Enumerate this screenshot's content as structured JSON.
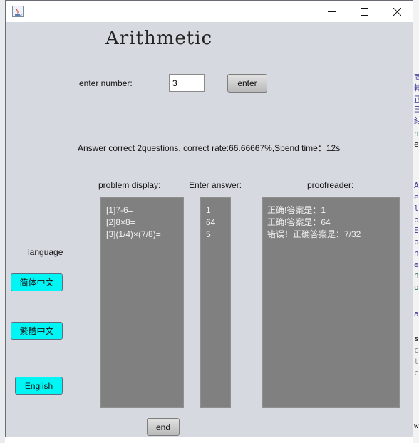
{
  "window": {
    "controls": {
      "minimize": "—",
      "maximize": "☐",
      "close": "✕"
    },
    "icon": "java-app-icon"
  },
  "app": {
    "title": "Arithmetic"
  },
  "input": {
    "label": "enter number:",
    "value": "3"
  },
  "buttons": {
    "enter": "enter",
    "end": "end"
  },
  "result_text": "Answer correct 2questions, correct rate:66.66667%,Spend time：12s",
  "columns": {
    "problem": "problem display:",
    "answer": "Enter answer:",
    "proofreader": "proofreader:"
  },
  "problems": [
    "[1]7-6=",
    "[2]8×8=",
    "[3](1/4)×(7/8)="
  ],
  "answers": [
    "1",
    "64",
    "5"
  ],
  "proofreader_lines": [
    "正确!答案是：1",
    "正确!答案是：64",
    " 错误！正确答案是：7/32"
  ],
  "language": {
    "label": "language",
    "options": [
      "简体中文",
      "繁體中文",
      "English"
    ]
  },
  "background_editor_fragments": [
    "商",
    "輸",
    "正",
    "三",
    "結",
    "n",
    "e",
    "A",
    "e",
    "l",
    "p",
    "E",
    "p",
    "n",
    "e",
    "n",
    "o",
    "a",
    "s",
    "c",
    "t",
    "c",
    "w"
  ],
  "colors": {
    "window_bg": "#d6d9df",
    "panel_bg": "#808080",
    "lang_button": "#00f5f5"
  }
}
